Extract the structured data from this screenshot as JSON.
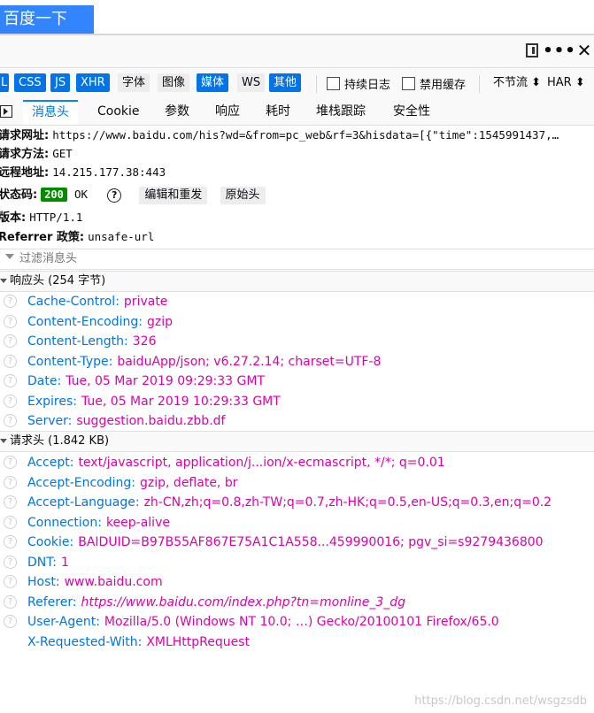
{
  "page": {
    "search_button": "百度一下"
  },
  "toolbar": {
    "more": "•••",
    "close": "✕"
  },
  "filters": {
    "chips": [
      {
        "label": "L",
        "active": true
      },
      {
        "label": "CSS",
        "active": true
      },
      {
        "label": "JS",
        "active": true
      },
      {
        "label": "XHR",
        "active": true
      },
      {
        "label": "字体",
        "active": false
      },
      {
        "label": "图像",
        "active": false
      },
      {
        "label": "媒体",
        "active": true
      },
      {
        "label": "WS",
        "active": false
      },
      {
        "label": "其他",
        "active": true
      }
    ],
    "persist_logs": "持续日志",
    "disable_cache": "禁用缓存",
    "throttle": "不节流 ⬍",
    "har": "HAR ⬍"
  },
  "tabs": [
    "消息头",
    "Cookie",
    "参数",
    "响应",
    "耗时",
    "堆栈跟踪",
    "安全性"
  ],
  "summary": {
    "request_url_label": "请求网址:",
    "request_url": "https://www.baidu.com/his?wd=&from=pc_web&rf=3&hisdata=[{\"time\":1545991437,…",
    "method_label": "请求方法:",
    "method": "GET",
    "remote_label": "远程地址:",
    "remote": "14.215.177.38:443",
    "status_label": "状态码:",
    "status_code": "200",
    "status_text": "OK",
    "help": "?",
    "edit_resend": "编辑和重发",
    "raw": "原始头",
    "version_label": "版本:",
    "version": "HTTP/1.1",
    "referrer_label": "Referrer 政策:",
    "referrer_policy": "unsafe-url"
  },
  "filter_headers_placeholder": "过滤消息头",
  "response_headers": {
    "title": "响应头 (254 字节)",
    "items": [
      {
        "name": "Cache-Control:",
        "value": "private"
      },
      {
        "name": "Content-Encoding:",
        "value": "gzip"
      },
      {
        "name": "Content-Length:",
        "value": "326"
      },
      {
        "name": "Content-Type:",
        "value": "baiduApp/json; v6.27.2.14; charset=UTF-8"
      },
      {
        "name": "Date:",
        "value": "Tue, 05 Mar 2019 09:29:33 GMT"
      },
      {
        "name": "Expires:",
        "value": "Tue, 05 Mar 2019 10:29:33 GMT"
      },
      {
        "name": "Server:",
        "value": "suggestion.baidu.zbb.df"
      }
    ]
  },
  "request_headers": {
    "title": "请求头 (1.842 KB)",
    "items": [
      {
        "name": "Accept:",
        "value": "text/javascript, application/j...ion/x-ecmascript, */*; q=0.01"
      },
      {
        "name": "Accept-Encoding:",
        "value": "gzip, deflate, br"
      },
      {
        "name": "Accept-Language:",
        "value": "zh-CN,zh;q=0.8,zh-TW;q=0.7,zh-HK;q=0.5,en-US;q=0.3,en;q=0.2"
      },
      {
        "name": "Connection:",
        "value": "keep-alive"
      },
      {
        "name": "Cookie:",
        "value": "BAIDUID=B97B55AF867E75A1C1A558...459990016; pgv_si=s9279436800"
      },
      {
        "name": "DNT:",
        "value": "1"
      },
      {
        "name": "Host:",
        "value": "www.baidu.com"
      },
      {
        "name": "Referer:",
        "value": "https://www.baidu.com/index.php?tn=monline_3_dg",
        "italic": true
      },
      {
        "name": "User-Agent:",
        "value": "Mozilla/5.0 (Windows NT 10.0; …) Gecko/20100101 Firefox/65.0"
      },
      {
        "name": "X-Requested-With:",
        "value": "XMLHttpRequest",
        "no_icon": true
      }
    ]
  },
  "watermark": "https://blog.csdn.net/wsgzsdb"
}
